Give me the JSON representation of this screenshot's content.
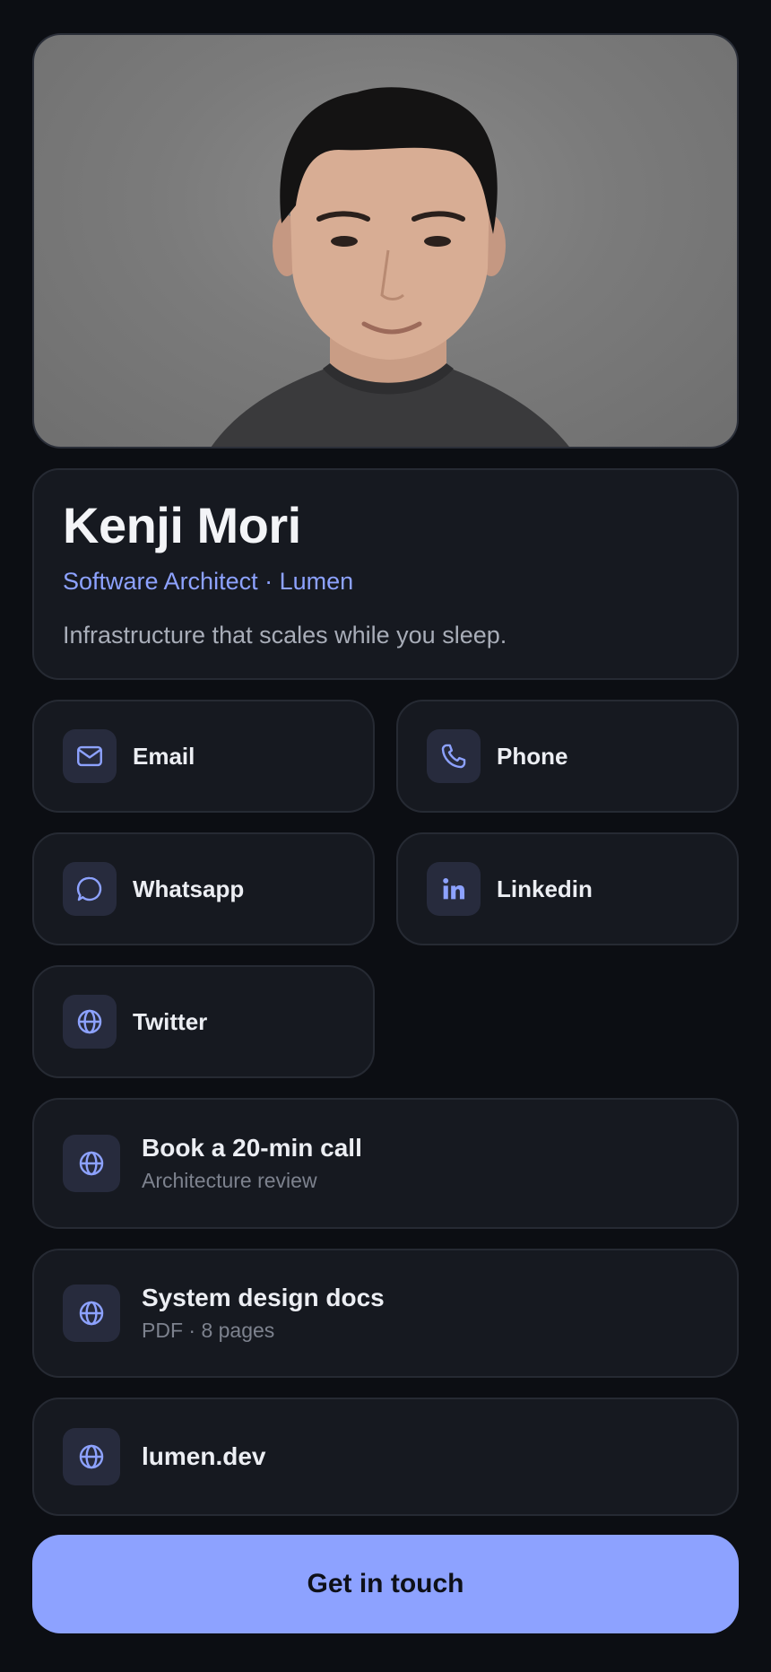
{
  "profile": {
    "name": "Kenji Mori",
    "role": "Software Architect · Lumen",
    "tagline": "Infrastructure that scales while you sleep."
  },
  "contacts": [
    {
      "label": "Email",
      "icon": "mail-icon"
    },
    {
      "label": "Phone",
      "icon": "phone-icon"
    },
    {
      "label": "Whatsapp",
      "icon": "chat-icon"
    },
    {
      "label": "Linkedin",
      "icon": "linkedin-icon"
    },
    {
      "label": "Twitter",
      "icon": "globe-icon"
    }
  ],
  "links": [
    {
      "title": "Book a 20-min call",
      "subtitle": "Architecture review",
      "icon": "globe-icon"
    },
    {
      "title": "System design docs",
      "subtitle": "PDF · 8 pages",
      "icon": "globe-icon"
    },
    {
      "title": "lumen.dev",
      "icon": "globe-icon"
    }
  ],
  "cta_label": "Get in touch",
  "colors": {
    "background": "#0c0e13",
    "card": "#161920",
    "accent": "#8da2ff",
    "icon_tile": "#272b3d"
  }
}
